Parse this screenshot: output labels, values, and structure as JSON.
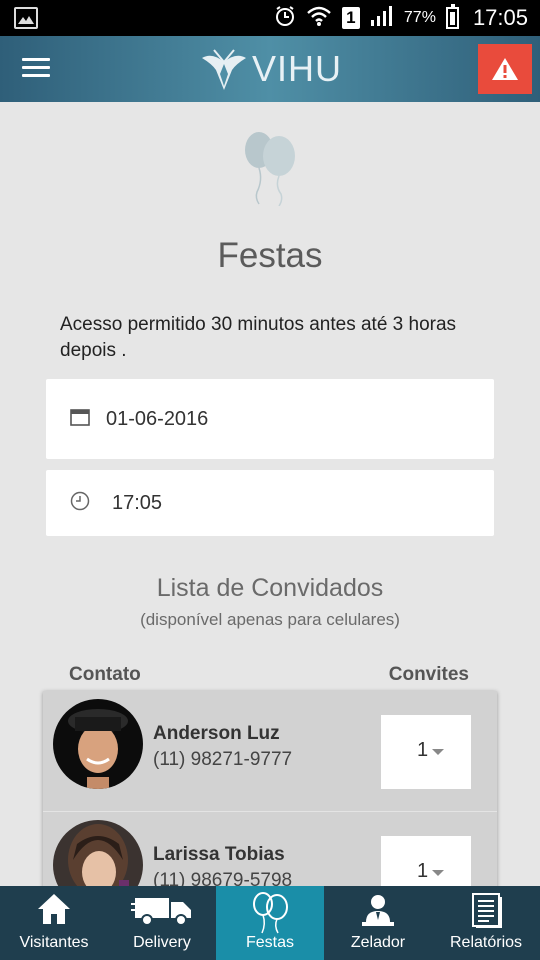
{
  "status_bar": {
    "battery": "77%",
    "time": "17:05",
    "sim": "1"
  },
  "app_bar": {
    "logo_text": "VIHU"
  },
  "page": {
    "title": "Festas",
    "access_note": "Acesso permitido 30 minutos antes até 3 horas depois .",
    "date_value": "01-06-2016",
    "time_value": "17:05"
  },
  "guests": {
    "title": "Lista de Convidados",
    "subtitle": "(disponível apenas para celulares)",
    "col_contact": "Contato",
    "col_invites": "Convites",
    "items": [
      {
        "name": "Anderson Luz",
        "phone": "(11) 98271-9777",
        "invites": "1"
      },
      {
        "name": "Larissa Tobias",
        "phone": "(11) 98679-5798",
        "invites": "1"
      }
    ]
  },
  "bottom_nav": {
    "items": [
      {
        "label": "Visitantes",
        "icon": "house-icon"
      },
      {
        "label": "Delivery",
        "icon": "truck-icon"
      },
      {
        "label": "Festas",
        "icon": "balloons-icon",
        "active": true
      },
      {
        "label": "Zelador",
        "icon": "janitor-icon"
      },
      {
        "label": "Relatórios",
        "icon": "report-icon"
      }
    ]
  },
  "colors": {
    "appbar": "#3f7b93",
    "alert": "#e94b3c",
    "nav": "#1f3e4e",
    "nav_active": "#1a8ea8"
  }
}
